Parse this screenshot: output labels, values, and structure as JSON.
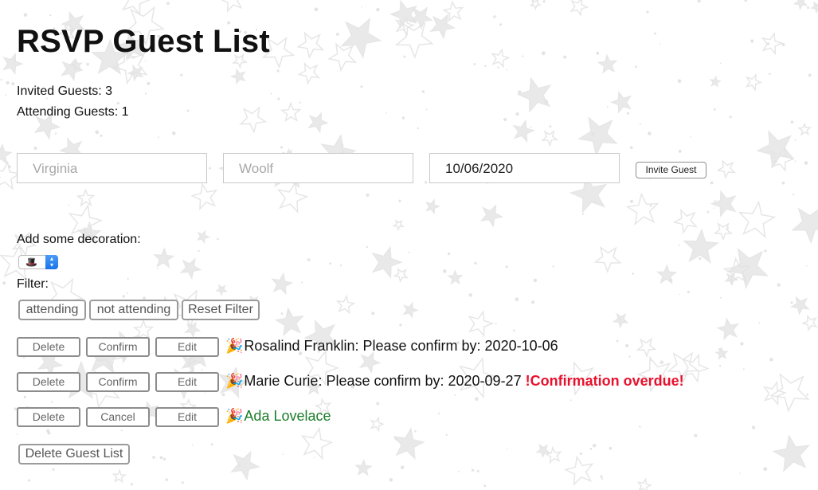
{
  "page": {
    "title": "RSVP Guest List",
    "invited_label": "Invited Guests: 3",
    "attending_label": "Attending Guests: 1"
  },
  "form": {
    "first_name_placeholder": "Virginia",
    "last_name_placeholder": "Woolf",
    "date_value": "10/06/2020",
    "invite_button": "Invite Guest"
  },
  "decoration": {
    "label": "Add some decoration:",
    "selected_icon": "top-hat-icon",
    "selected_glyph": "🎩"
  },
  "filter": {
    "label": "Filter:",
    "buttons": [
      "attending",
      "not attending",
      "Reset Filter"
    ]
  },
  "guests": [
    {
      "delete_label": "Delete",
      "toggle_label": "Confirm",
      "edit_label": "Edit",
      "icon": "party-popper-icon",
      "glyph": "🎉",
      "text": "Rosalind Franklin: Please confirm by: 2020-10-06",
      "warning": "",
      "status": "pending"
    },
    {
      "delete_label": "Delete",
      "toggle_label": "Confirm",
      "edit_label": "Edit",
      "icon": "party-popper-icon",
      "glyph": "🎉",
      "text": "Marie Curie: Please confirm by: 2020-09-27",
      "warning": "!Confirmation overdue!",
      "status": "overdue"
    },
    {
      "delete_label": "Delete",
      "toggle_label": "Cancel",
      "edit_label": "Edit",
      "icon": "party-popper-icon",
      "glyph": "🎉",
      "text": "Ada Lovelace",
      "warning": "",
      "status": "attending"
    }
  ],
  "delete_all_button": "Delete Guest List",
  "colors": {
    "overdue": "#e8112d",
    "attending": "#1c7d2a",
    "background_stars": "#e6e6e6"
  }
}
